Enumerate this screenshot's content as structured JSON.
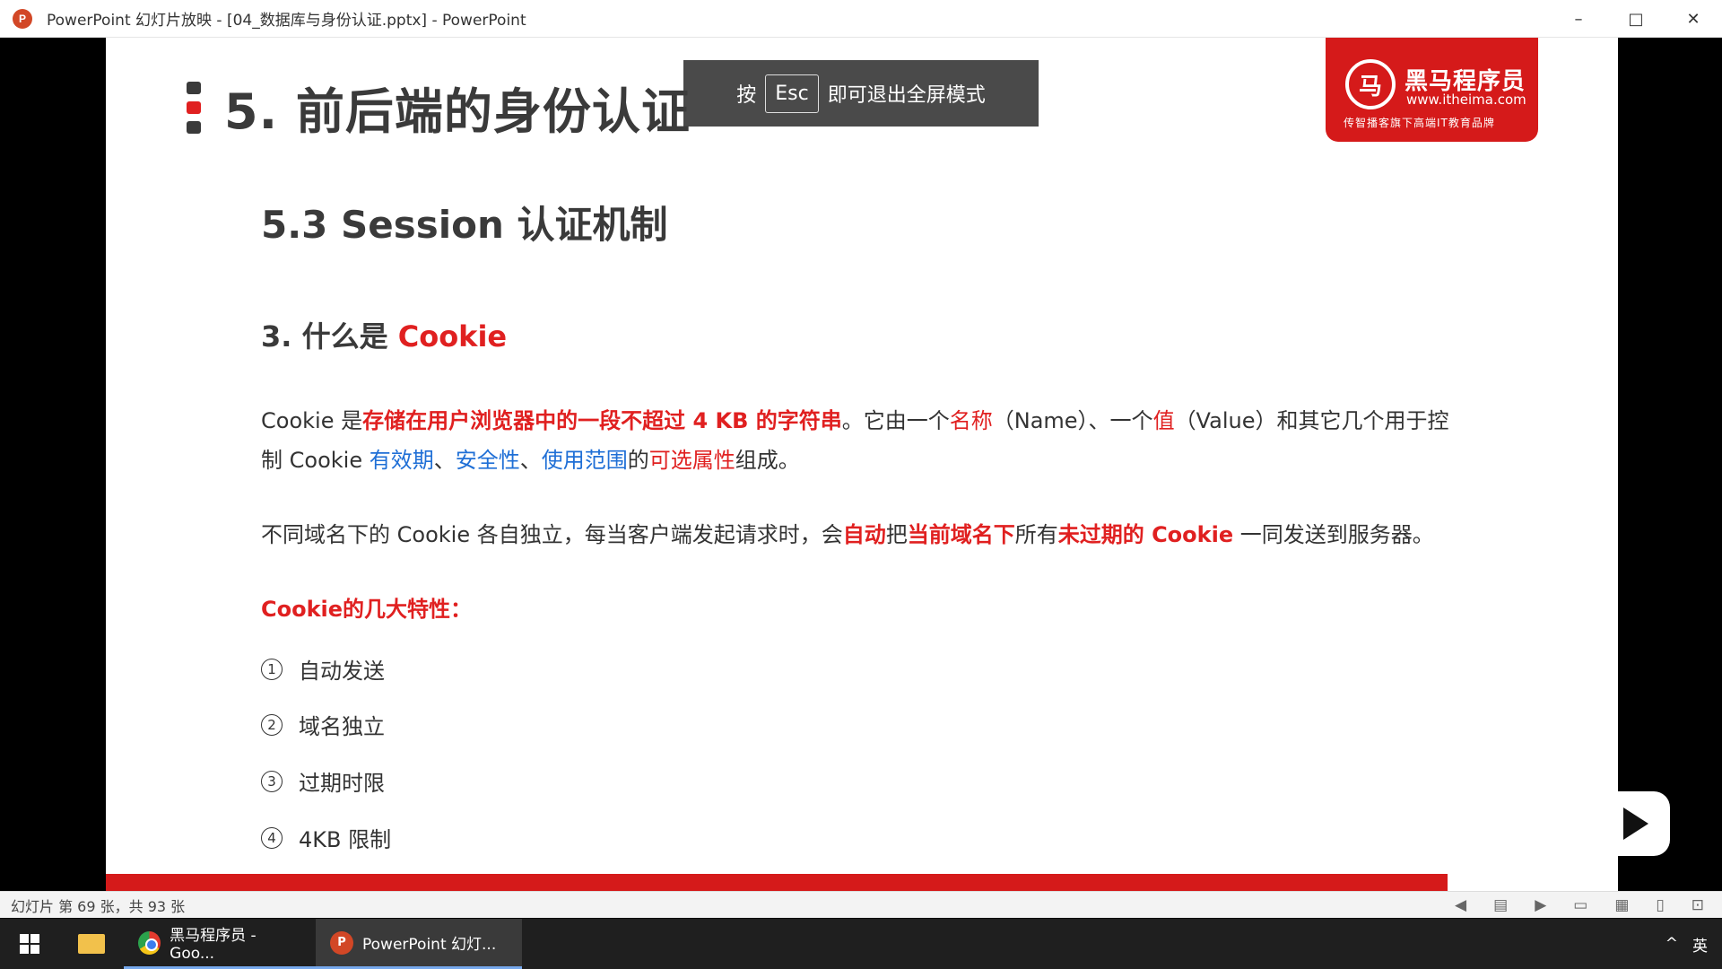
{
  "window": {
    "title": "PowerPoint 幻灯片放映 - [04_数据库与身份认证.pptx] - PowerPoint",
    "app_icon": "P",
    "minimize": "–",
    "maximize": "□",
    "close": "✕"
  },
  "slide": {
    "main_title": "5. 前后端的身份认证",
    "esc_tip": {
      "prefix": "按",
      "key": "Esc",
      "suffix": "即可退出全屏模式"
    },
    "logo": {
      "icon": "马",
      "name": "黑马程序员",
      "url": "www.itheima.com",
      "slogan": "传智播客旗下高端IT教育品牌"
    },
    "subtitle": "5.3 Session 认证机制",
    "section": {
      "prefix": "3. 什么是 ",
      "highlight": "Cookie"
    },
    "paragraph1": {
      "p1": "Cookie 是",
      "p2": "存储在用户浏览器中的一段不超过 4 KB 的字符串",
      "p3": "。它由一个",
      "p4": "名称",
      "p5": "（Name）、一个",
      "p6": "值",
      "p7": "（Value）和其它几个用于控制 Cookie ",
      "p8": "有效期",
      "p9": "、",
      "p10": "安全性",
      "p11": "、",
      "p12": "使用范围",
      "p13": "的",
      "p14": "可选属性",
      "p15": "组成。"
    },
    "paragraph2": {
      "p1": "不同域名下的 Cookie 各自独立，每当客户端发起请求时，会",
      "p2": "自动",
      "p3": "把",
      "p4": "当前域名下",
      "p5": "所有",
      "p6": "未过期的 Cookie",
      "p7": " 一同发送到服务器。"
    },
    "features_title": "Cookie的几大特性：",
    "features": [
      {
        "num": "1",
        "label": "自动发送"
      },
      {
        "num": "2",
        "label": "域名独立"
      },
      {
        "num": "3",
        "label": "过期时限"
      },
      {
        "num": "4",
        "label": "4KB 限制"
      }
    ]
  },
  "statusbar": {
    "slide_info": "幻灯片 第 69 张，共 93 张"
  },
  "taskbar": {
    "chrome_label": "黑马程序员 - Goo...",
    "ppt_label": "PowerPoint 幻灯...",
    "ppt_icon": "P",
    "tray_lang": "英",
    "tray_chevron": "^"
  }
}
